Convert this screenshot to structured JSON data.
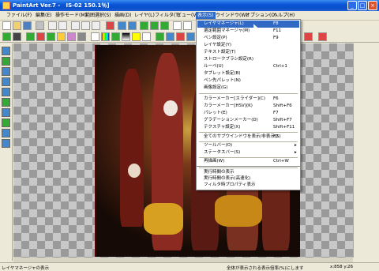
{
  "titlebar": {
    "title": "PaintArt Ver.7 -   IS-02 150.1％]"
  },
  "menu": [
    {
      "label": "ファイル(F)"
    },
    {
      "label": "編集(E)"
    },
    {
      "label": "操作モード(M)"
    },
    {
      "label": "範囲選択(S)"
    },
    {
      "label": "描画(D)"
    },
    {
      "label": "レイヤ(L)"
    },
    {
      "label": "フィルタ(T)"
    },
    {
      "label": "ビュー(V)"
    },
    {
      "label": "表示(S)"
    },
    {
      "label": "ウインドウ(W)"
    },
    {
      "label": "オプション(O)"
    },
    {
      "label": "ヘルプ(H)"
    }
  ],
  "dropdown": {
    "items": [
      {
        "label": "レイヤマネージャ(L)",
        "shortcut": "F8"
      },
      {
        "label": "選定範囲マネージャ(M)",
        "shortcut": "F11"
      },
      {
        "label": "ペン設定(P)",
        "shortcut": "F9"
      },
      {
        "label": "レイヤ設定(Y)",
        "shortcut": ""
      },
      {
        "label": "テキスト設定(T)",
        "shortcut": ""
      },
      {
        "label": "ストロークブラシ設定(R)",
        "shortcut": ""
      },
      {
        "label": "ルーペ(U)",
        "shortcut": "Ctrl+1"
      },
      {
        "label": "タブレット設定(B)",
        "shortcut": ""
      },
      {
        "label": "ペン先パレット(N)",
        "shortcut": ""
      },
      {
        "label": "画像設定(G)",
        "shortcut": ""
      },
      {
        "label": "カラーメーカー[スライダー](C)",
        "shortcut": "F6"
      },
      {
        "label": "カラーメーカー[HSV](K)",
        "shortcut": "Shift+F6"
      },
      {
        "label": "パレット(E)",
        "shortcut": "F7"
      },
      {
        "label": "グラデーションメーカー(D)",
        "shortcut": "Shift+F7"
      },
      {
        "label": "テクスチャ設定(X)",
        "shortcut": "Shift+F11"
      },
      {
        "label": "全てのサブウインドウを表示/非表示(S)",
        "shortcut": "F2"
      },
      {
        "label": "ツールバー(O)",
        "shortcut": ""
      },
      {
        "label": "ステータスバー(S)",
        "shortcut": ""
      },
      {
        "label": "再描画(W)",
        "shortcut": "Ctrl+W"
      },
      {
        "label": "実行時間の表示",
        "shortcut": ""
      },
      {
        "label": "実行時間の表示(高速化)",
        "shortcut": ""
      },
      {
        "label": "フィルタ時プロパティ表示",
        "shortcut": ""
      }
    ]
  },
  "status": {
    "left": "レイヤマネージャの表示",
    "mid": "全体が表示される表示倍率(%)にします",
    "right": "x:858 y:26"
  },
  "colors": {
    "titlebar": "#0a56d8",
    "highlight": "#316ac5"
  }
}
